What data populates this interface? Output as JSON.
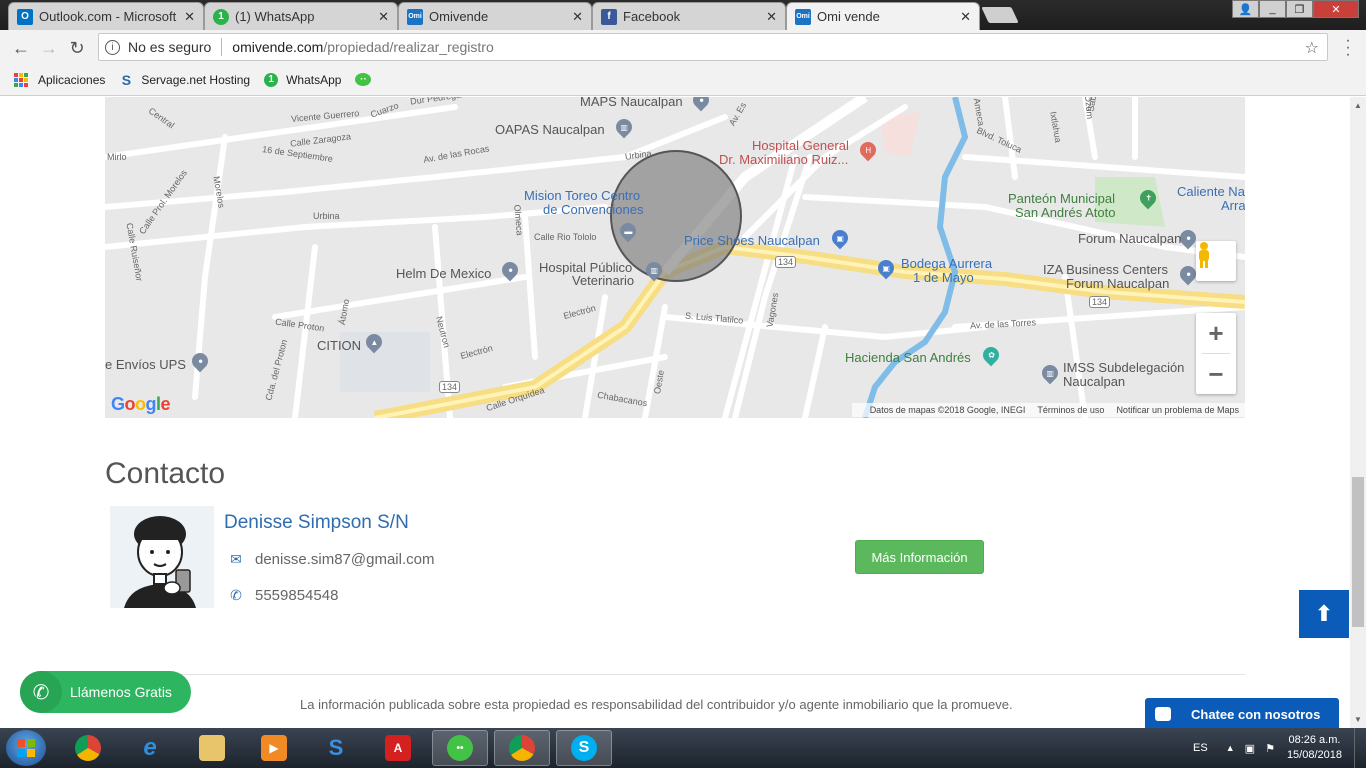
{
  "browser": {
    "tabs": [
      {
        "title": "Outlook.com - Microsoft",
        "icon": "outlook-icon",
        "color": "#0072c6",
        "glyph": "O"
      },
      {
        "title": "(1) WhatsApp",
        "icon": "whatsapp-icon",
        "color": "#2ab34a",
        "glyph": "1"
      },
      {
        "title": "Omivende",
        "icon": "omivende-icon",
        "color": "#1b73c5",
        "glyph": "Omi"
      },
      {
        "title": "Facebook",
        "icon": "facebook-icon",
        "color": "#3b5998",
        "glyph": "f"
      },
      {
        "title": "Omi vende",
        "icon": "omivende-icon",
        "color": "#1b73c5",
        "glyph": "Omi"
      }
    ],
    "active_tab": 4,
    "close_glyph": "✕",
    "address": {
      "security": "No es seguro",
      "host": "omivende.com",
      "path": "/propiedad/realizar_registro"
    },
    "bookmarks": [
      {
        "label": "Aplicaciones",
        "icon": "apps-grid-icon"
      },
      {
        "label": "Servage.net Hosting",
        "icon": "servage-icon",
        "glyph": "S"
      },
      {
        "label": "WhatsApp",
        "icon": "whatsapp-icon",
        "glyph": "1"
      },
      {
        "label": "",
        "icon": "wechat-icon"
      }
    ]
  },
  "map": {
    "labels": {
      "maps_naucalpan": "MAPS Naucalpan",
      "oapas": "OAPAS Naucalpan",
      "hospital_general_1": "Hospital General",
      "hospital_general_2": "Dr. Maximiliano Ruiz...",
      "mision_toreo_1": "Mision Toreo Centro",
      "mision_toreo_2": "de Convenciones",
      "price_shoes": "Price Shoes Naucalpan",
      "panteon_1": "Panteón Municipal",
      "panteon_2": "San Andrés Atoto",
      "caliente_1": "Caliente Na",
      "caliente_2": "Arra",
      "forum": "Forum Naucalpan",
      "helm": "Helm De Mexico",
      "hospital_pub_1": "Hospital Público",
      "hospital_pub_2": "Veterinario",
      "bodega_1": "Bodega Aurrera",
      "bodega_2": "1 de Mayo",
      "iza_1": "IZA Business Centers",
      "iza_2": "Forum Naucalpan",
      "cition": "CITION",
      "hacienda": "Hacienda San Andrés",
      "imss_1": "IMSS Subdelegación",
      "imss_2": "Naucalpan",
      "envios": "e Envíos UPS",
      "route1": "134",
      "route2": "134",
      "route3": "134",
      "route4": "134"
    },
    "streets": {
      "central": "Central",
      "cuarzo": "Cuarzo",
      "pedregal": "Dur Pedregal",
      "guerrero": "Vicente Guerrero",
      "zaragoza": "Calle Zaragoza",
      "sept": "16 de Septiembre",
      "mirlo": "Mirlo",
      "rocas": "Av. de las Rocas",
      "urbina1": "Urbina",
      "urbina2": "Urbina",
      "morelos": "Calle Prol. Morelos",
      "morelos2": "Morelos",
      "rio_tololo": "Calle Rio Tololo",
      "olmeca": "Olmeca",
      "ruisenor": "Calle Ruiseñor",
      "proton": "Calle Proton",
      "atomo": "Átomo",
      "electron1": "Electrón",
      "electron2": "Electrón",
      "neutron": "Neutron",
      "prol_proton": "Cda. del Proton",
      "orquidea": "Calle Orquídea",
      "chabacanos": "Chabacanos",
      "luis_tlatilco": "S. Luis Tlatilco",
      "vagones": "Vagones",
      "oeste": "Oeste",
      "torres": "Av. de las Torres",
      "toluca": "Blvd. Toluca",
      "ameca": "Ameca",
      "ixtlahua": "Ixtlahua",
      "ozumba": "Ozum",
      "sabin": "Sabin",
      "est": "Av. Es"
    },
    "zoom_in": "+",
    "zoom_out": "−",
    "google": [
      "G",
      "o",
      "o",
      "g",
      "l",
      "e"
    ],
    "google_colors": [
      "#4285f4",
      "#ea4335",
      "#fbbc05",
      "#4285f4",
      "#34a853",
      "#ea4335"
    ],
    "attribution": {
      "data": "Datos de mapas ©2018 Google, INEGI",
      "terms": "Términos de uso",
      "report": "Notificar un problema de Maps"
    }
  },
  "contact": {
    "heading": "Contacto",
    "name": "Denisse Simpson S/N",
    "email": "denisse.sim87@gmail.com",
    "phone": "5559854548",
    "more_button": "Más Información"
  },
  "footer": {
    "note": "La información publicada sobre esta propiedad es responsabilidad del contribuidor y/o agente inmobiliario que la promueve."
  },
  "widgets": {
    "call_label": "Llámenos Gratis",
    "chat_label": "Chatee con nosotros",
    "scroll_top": "⬆"
  },
  "taskbar": {
    "apps": [
      {
        "icon": "chrome-icon",
        "open": false
      },
      {
        "icon": "internet-explorer-icon",
        "open": false
      },
      {
        "icon": "file-explorer-icon",
        "open": false
      },
      {
        "icon": "media-player-icon",
        "open": false
      },
      {
        "icon": "servage-app-icon",
        "open": false
      },
      {
        "icon": "acrobat-icon",
        "open": false
      },
      {
        "icon": "wechat-icon",
        "open": true
      },
      {
        "icon": "chrome-icon",
        "open": true
      },
      {
        "icon": "skype-icon",
        "open": true
      }
    ],
    "language": "ES",
    "time": "08:26 a.m.",
    "date": "15/08/2018"
  },
  "colors": {
    "accent": "#2f6cb0",
    "success": "#5cb85c",
    "chat": "#0a5cb8",
    "call": "#2db560"
  }
}
